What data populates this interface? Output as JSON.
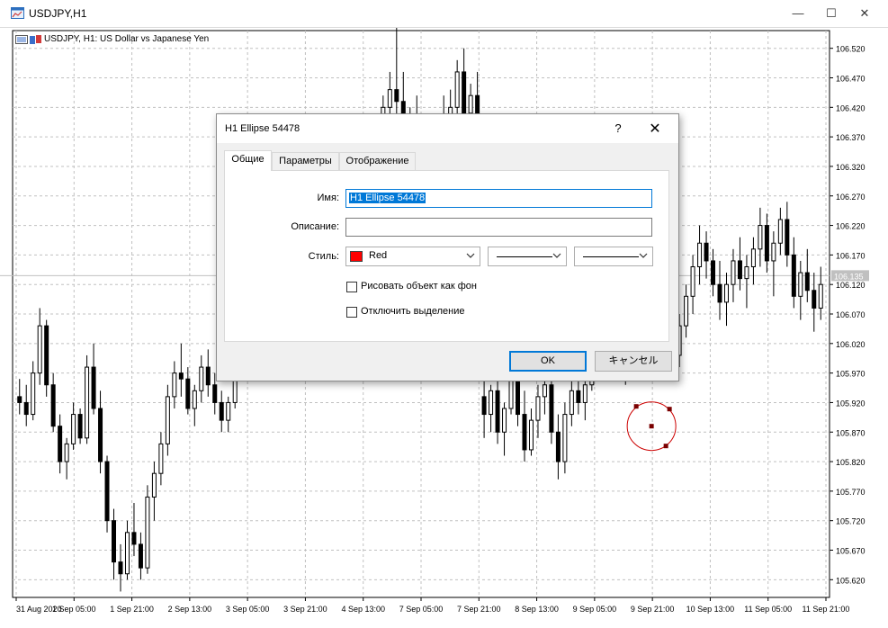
{
  "window": {
    "title": "USDJPY,H1",
    "minimize_glyph": "—",
    "maximize_glyph": "☐",
    "close_glyph": "✕"
  },
  "chart_header": {
    "text": "USDJPY, H1:  US Dollar vs Japanese Yen"
  },
  "chart_data": {
    "type": "candlestick",
    "symbol": "USDJPY",
    "timeframe": "H1",
    "current_price": "106.135",
    "price_ticks": [
      "106.520",
      "106.470",
      "106.420",
      "106.370",
      "106.320",
      "106.270",
      "106.220",
      "106.170",
      "106.120",
      "106.070",
      "106.020",
      "105.970",
      "105.920",
      "105.870",
      "105.820",
      "105.770",
      "105.720",
      "105.670",
      "105.620"
    ],
    "time_ticks": [
      "31 Aug 2020",
      "1 Sep 05:00",
      "1 Sep 21:00",
      "2 Sep 13:00",
      "3 Sep 05:00",
      "3 Sep 21:00",
      "4 Sep 13:00",
      "7 Sep 05:00",
      "7 Sep 21:00",
      "8 Sep 13:00",
      "9 Sep 05:00",
      "9 Sep 21:00",
      "10 Sep 13:00",
      "11 Sep 05:00",
      "11 Sep 21:00"
    ],
    "ylim": [
      105.59,
      106.55
    ],
    "grid": true,
    "colors": {
      "candle": "#000000",
      "grid": "#c0c0c0",
      "ellipse": "#cc0000",
      "bid_line": "#c0c0c0"
    },
    "candles": [
      [
        105.93,
        105.96,
        105.9,
        105.92
      ],
      [
        105.92,
        105.95,
        105.88,
        105.9
      ],
      [
        105.9,
        105.99,
        105.89,
        105.97
      ],
      [
        105.97,
        106.08,
        105.95,
        106.05
      ],
      [
        106.05,
        106.06,
        105.93,
        105.95
      ],
      [
        105.95,
        105.97,
        105.87,
        105.88
      ],
      [
        105.88,
        105.9,
        105.8,
        105.82
      ],
      [
        105.82,
        105.86,
        105.79,
        105.85
      ],
      [
        105.85,
        105.92,
        105.84,
        105.9
      ],
      [
        105.9,
        105.91,
        105.85,
        105.86
      ],
      [
        105.86,
        106.0,
        105.85,
        105.98
      ],
      [
        105.98,
        106.02,
        105.9,
        105.91
      ],
      [
        105.91,
        105.94,
        105.8,
        105.82
      ],
      [
        105.82,
        105.83,
        105.7,
        105.72
      ],
      [
        105.72,
        105.74,
        105.62,
        105.65
      ],
      [
        105.65,
        105.68,
        105.6,
        105.63
      ],
      [
        105.63,
        105.72,
        105.62,
        105.7
      ],
      [
        105.7,
        105.75,
        105.66,
        105.68
      ],
      [
        105.68,
        105.7,
        105.62,
        105.64
      ],
      [
        105.64,
        105.78,
        105.63,
        105.76
      ],
      [
        105.76,
        105.82,
        105.72,
        105.8
      ],
      [
        105.8,
        105.87,
        105.78,
        105.85
      ],
      [
        105.85,
        105.95,
        105.83,
        105.93
      ],
      [
        105.93,
        105.99,
        105.91,
        105.97
      ],
      [
        105.97,
        106.02,
        105.93,
        105.96
      ],
      [
        105.96,
        105.98,
        105.9,
        105.91
      ],
      [
        105.91,
        105.95,
        105.88,
        105.94
      ],
      [
        105.94,
        106.0,
        105.92,
        105.98
      ],
      [
        105.98,
        106.01,
        105.93,
        105.95
      ],
      [
        105.95,
        105.97,
        105.9,
        105.92
      ],
      [
        105.92,
        105.94,
        105.87,
        105.89
      ],
      [
        105.89,
        105.93,
        105.87,
        105.92
      ],
      [
        105.92,
        106.0,
        105.91,
        105.99
      ],
      [
        105.99,
        106.06,
        105.97,
        106.05
      ],
      [
        106.05,
        106.08,
        106.0,
        106.02
      ],
      [
        106.02,
        106.05,
        105.99,
        106.04
      ],
      [
        106.04,
        106.12,
        106.03,
        106.1
      ],
      [
        106.1,
        106.2,
        106.08,
        106.18
      ],
      [
        106.18,
        106.22,
        106.12,
        106.15
      ],
      [
        106.15,
        106.28,
        106.13,
        106.25
      ],
      [
        106.25,
        106.3,
        106.18,
        106.2
      ],
      [
        106.2,
        106.24,
        106.14,
        106.16
      ],
      [
        106.16,
        106.21,
        106.12,
        106.19
      ],
      [
        106.19,
        106.23,
        106.15,
        106.17
      ],
      [
        106.17,
        106.2,
        106.13,
        106.15
      ],
      [
        106.15,
        106.18,
        106.12,
        106.16
      ],
      [
        106.16,
        106.2,
        106.14,
        106.18
      ],
      [
        106.18,
        106.25,
        106.16,
        106.22
      ],
      [
        106.22,
        106.26,
        106.17,
        106.19
      ],
      [
        106.19,
        106.22,
        106.14,
        106.16
      ],
      [
        106.16,
        106.22,
        106.15,
        106.2
      ],
      [
        106.2,
        106.3,
        106.18,
        106.28
      ],
      [
        106.28,
        106.35,
        106.25,
        106.32
      ],
      [
        106.32,
        106.38,
        106.28,
        106.35
      ],
      [
        106.35,
        106.44,
        106.3,
        106.42
      ],
      [
        106.42,
        106.48,
        106.36,
        106.45
      ],
      [
        106.45,
        106.56,
        106.4,
        106.43
      ],
      [
        106.43,
        106.48,
        106.35,
        106.37
      ],
      [
        106.37,
        106.42,
        106.32,
        106.4
      ],
      [
        106.4,
        106.44,
        106.34,
        106.36
      ],
      [
        106.36,
        106.4,
        106.3,
        106.33
      ],
      [
        106.33,
        106.38,
        106.29,
        106.35
      ],
      [
        106.35,
        106.4,
        106.32,
        106.38
      ],
      [
        106.38,
        106.44,
        106.35,
        106.4
      ],
      [
        106.4,
        106.45,
        106.36,
        106.42
      ],
      [
        106.42,
        106.5,
        106.4,
        106.48
      ],
      [
        106.48,
        106.52,
        106.4,
        106.41
      ],
      [
        106.41,
        106.46,
        106.36,
        106.44
      ],
      [
        106.44,
        106.48,
        106.38,
        106.4
      ],
      [
        105.93,
        105.97,
        105.86,
        105.9
      ],
      [
        105.9,
        105.95,
        105.87,
        105.94
      ],
      [
        105.94,
        105.97,
        105.85,
        105.87
      ],
      [
        105.87,
        105.92,
        105.83,
        105.91
      ],
      [
        105.91,
        105.98,
        105.9,
        105.96
      ],
      [
        105.96,
        105.99,
        105.88,
        105.9
      ],
      [
        105.9,
        105.94,
        105.82,
        105.84
      ],
      [
        105.84,
        105.91,
        105.83,
        105.89
      ],
      [
        105.89,
        105.95,
        105.86,
        105.93
      ],
      [
        105.93,
        105.98,
        105.9,
        105.95
      ],
      [
        105.95,
        105.97,
        105.85,
        105.87
      ],
      [
        105.87,
        105.9,
        105.79,
        105.82
      ],
      [
        105.82,
        105.92,
        105.8,
        105.9
      ],
      [
        105.9,
        105.96,
        105.88,
        105.94
      ],
      [
        105.94,
        105.98,
        105.9,
        105.92
      ],
      [
        105.92,
        105.96,
        105.89,
        105.95
      ],
      [
        105.95,
        106.1,
        105.94,
        106.08
      ],
      [
        106.08,
        106.12,
        106.02,
        106.04
      ],
      [
        106.04,
        106.1,
        106.0,
        106.07
      ],
      [
        106.07,
        106.13,
        106.03,
        106.05
      ],
      [
        106.05,
        106.08,
        105.99,
        106.01
      ],
      [
        106.01,
        106.05,
        105.95,
        106.03
      ],
      [
        106.03,
        106.15,
        106.02,
        106.12
      ],
      [
        106.12,
        106.18,
        106.08,
        106.1
      ],
      [
        106.1,
        106.14,
        106.04,
        106.06
      ],
      [
        106.06,
        106.09,
        106.0,
        106.02
      ],
      [
        106.02,
        106.08,
        105.99,
        106.06
      ],
      [
        106.06,
        106.11,
        106.03,
        106.09
      ],
      [
        106.09,
        106.14,
        105.97,
        106.0
      ],
      [
        106.0,
        106.07,
        105.98,
        106.05
      ],
      [
        106.05,
        106.12,
        106.03,
        106.1
      ],
      [
        106.1,
        106.17,
        106.07,
        106.15
      ],
      [
        106.15,
        106.22,
        106.12,
        106.19
      ],
      [
        106.19,
        106.21,
        106.13,
        106.16
      ],
      [
        106.16,
        106.18,
        106.1,
        106.12
      ],
      [
        106.12,
        106.16,
        106.06,
        106.09
      ],
      [
        106.09,
        106.14,
        106.05,
        106.12
      ],
      [
        106.12,
        106.18,
        106.09,
        106.16
      ],
      [
        106.16,
        106.2,
        106.11,
        106.13
      ],
      [
        106.13,
        106.17,
        106.08,
        106.15
      ],
      [
        106.15,
        106.2,
        106.12,
        106.18
      ],
      [
        106.18,
        106.25,
        106.15,
        106.22
      ],
      [
        106.22,
        106.24,
        106.14,
        106.16
      ],
      [
        106.16,
        106.21,
        106.1,
        106.19
      ],
      [
        106.19,
        106.25,
        106.17,
        106.23
      ],
      [
        106.23,
        106.26,
        106.15,
        106.17
      ],
      [
        106.17,
        106.2,
        106.08,
        106.1
      ],
      [
        106.1,
        106.16,
        106.06,
        106.14
      ],
      [
        106.14,
        106.18,
        106.09,
        106.11
      ],
      [
        106.11,
        106.14,
        106.04,
        106.08
      ],
      [
        106.08,
        106.15,
        106.06,
        106.12
      ]
    ],
    "ellipse": {
      "name": "H1 Ellipse 54478",
      "center_time": "9 Sep 21:00",
      "center_price": 105.88
    }
  },
  "dialog": {
    "title": "H1 Ellipse 54478",
    "help_glyph": "?",
    "close_glyph": "✕",
    "tabs": [
      "Общие",
      "Параметры",
      "Отображение"
    ],
    "name_label": "Имя:",
    "name_value": "H1 Ellipse 54478",
    "description_label": "Описание:",
    "description_value": "",
    "style_label": "Стиль:",
    "color_value": "Red",
    "color_hex": "#ff0000",
    "background_checkbox": "Рисовать объект как фон",
    "disable_selection_checkbox": "Отключить выделение",
    "ok_button": "OK",
    "cancel_button": "キャンセル"
  }
}
